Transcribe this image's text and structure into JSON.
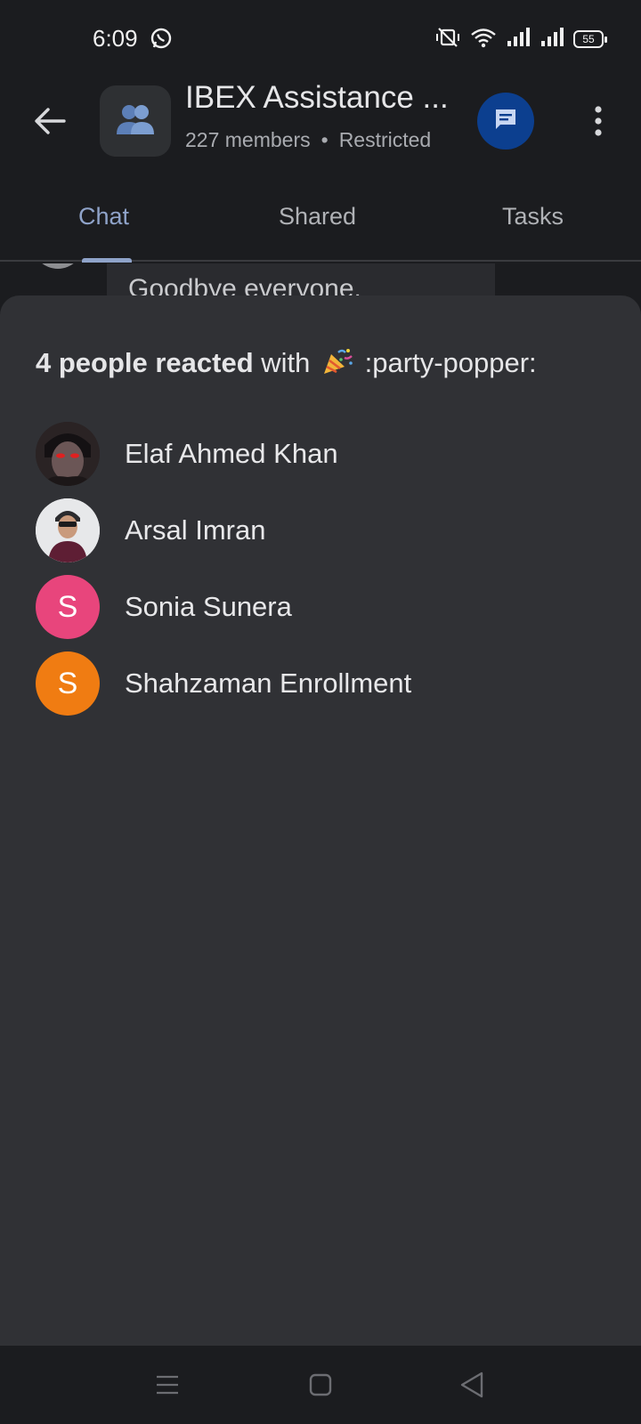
{
  "status_bar": {
    "time": "6:09",
    "left_icon": "whatsapp-icon",
    "right_icons": [
      "vibrate-off-icon",
      "wifi-icon",
      "signal-icon",
      "signal-icon"
    ],
    "battery": "55"
  },
  "header": {
    "title": "IBEX Assistance ...",
    "members": "227 members",
    "separator": "•",
    "access": "Restricted",
    "group_icon": "group-people-icon",
    "compose_icon": "chat-bubble-icon",
    "more_icon": "more-vert-icon"
  },
  "tabs": [
    {
      "label": "Chat",
      "active": true
    },
    {
      "label": "Shared",
      "active": false
    },
    {
      "label": "Tasks",
      "active": false
    }
  ],
  "background_message": "Goodbye everyone.",
  "reaction_sheet": {
    "count_text": "4 people reacted",
    "with_text": "with",
    "emoji_icon": "party-popper-icon",
    "emoji_code": ":party-popper:",
    "reactors": [
      {
        "name": "Elaf Ahmed Khan",
        "avatar_type": "photo",
        "initial": ""
      },
      {
        "name": "Arsal Imran",
        "avatar_type": "photo",
        "initial": ""
      },
      {
        "name": "Sonia Sunera",
        "avatar_type": "initial",
        "initial": "S",
        "color": "#e8457c"
      },
      {
        "name": "Shahzaman Enrollment",
        "avatar_type": "initial",
        "initial": "S",
        "color": "#f07c12"
      }
    ]
  },
  "nav_bar": {
    "buttons": [
      "menu-icon",
      "home-square-icon",
      "back-triangle-icon"
    ]
  },
  "colors": {
    "background": "#1b1c1f",
    "sheet": "#303135",
    "accent_tab": "#8fa3c9",
    "fab": "#0c3f8f"
  }
}
